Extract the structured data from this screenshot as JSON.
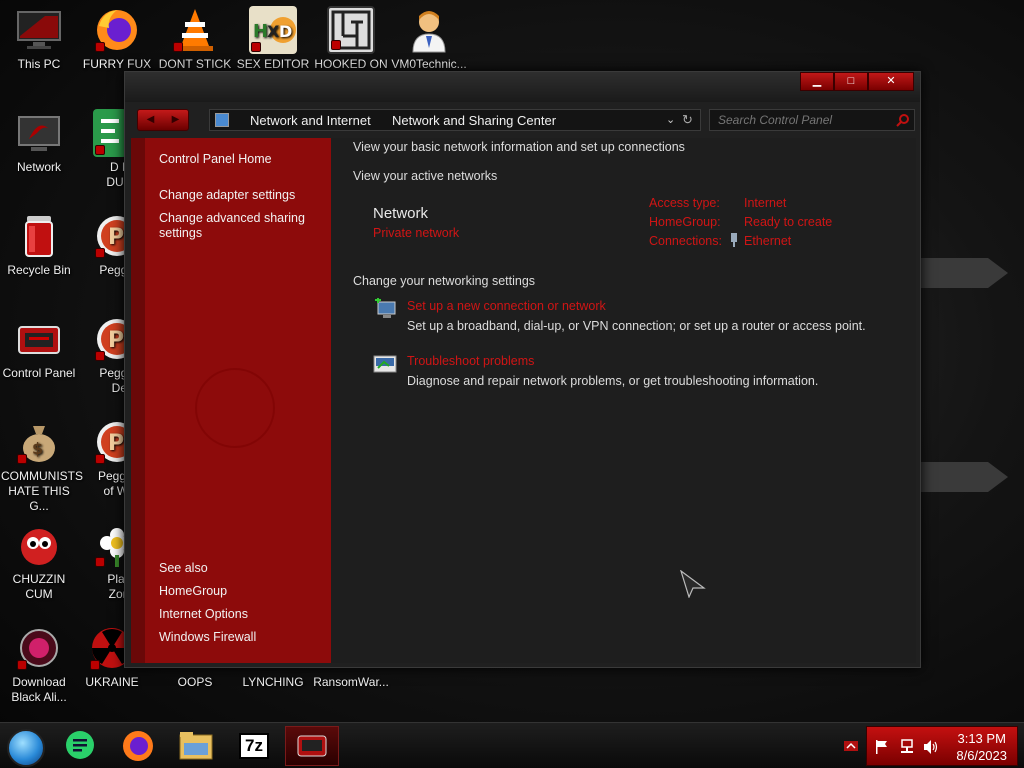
{
  "desktop": {
    "icons": [
      {
        "label": "This PC",
        "label2": ""
      },
      {
        "label": "FURRY FUX",
        "label2": ""
      },
      {
        "label": "DONT STICK",
        "label2": ""
      },
      {
        "label": "SEX EDITOR",
        "label2": ""
      },
      {
        "label": "HOOKED ON",
        "label2": ""
      },
      {
        "label": "VM0Technic...",
        "label2": ""
      },
      {
        "label": "Network",
        "label2": ""
      },
      {
        "label": "D FC",
        "label2": "DUMB"
      },
      {
        "label": "Recycle Bin",
        "label2": ""
      },
      {
        "label": "Peggle D",
        "label2": ""
      },
      {
        "label": "Control Panel",
        "label2": ""
      },
      {
        "label": "Peggle N",
        "label2": "Delu"
      },
      {
        "label": "COMMUNISTS",
        "label2": "HATE THIS G..."
      },
      {
        "label": "Peggle W",
        "label2": "of Warc"
      },
      {
        "label": "CHUZZIN",
        "label2": "CUM"
      },
      {
        "label": "Plants",
        "label2": "Zomb"
      },
      {
        "label": "Download",
        "label2": "Black Ali..."
      },
      {
        "label": "UKRAINE",
        "label2": ""
      },
      {
        "label": "OOPS",
        "label2": ""
      },
      {
        "label": "LYNCHING",
        "label2": ""
      },
      {
        "label": "RansomWar...",
        "label2": ""
      }
    ]
  },
  "window": {
    "buttons": {
      "minimize": "▁",
      "maximize": "□",
      "close": "✕"
    },
    "nav": {
      "back": "◀",
      "forward": "▶"
    },
    "address": {
      "crumb1": "Network and Internet",
      "crumb2": "Network and Sharing Center",
      "dropdown": "⌄",
      "refresh": "↻"
    },
    "search": {
      "placeholder": "Search Control Panel"
    },
    "left": {
      "home": "Control Panel Home",
      "adapter": "Change adapter settings",
      "sharing": "Change advanced sharing settings",
      "see_also": "See also",
      "homegroup": "HomeGroup",
      "internet_options": "Internet Options",
      "firewall": "Windows Firewall"
    },
    "main": {
      "heading": "View your basic network information and set up connections",
      "active_networks": "View your active networks",
      "network_name": "Network",
      "network_type": "Private network",
      "access_type_label": "Access type:",
      "access_type_value": "Internet",
      "homegroup_label": "HomeGroup:",
      "homegroup_value": "Ready to create",
      "connections_label": "Connections:",
      "connections_value": "Ethernet",
      "change_settings": "Change your networking settings",
      "setup_link": "Set up a new connection or network",
      "setup_desc": "Set up a broadband, dial-up, or VPN connection; or set up a router or access point.",
      "troubleshoot_link": "Troubleshoot problems",
      "troubleshoot_desc": "Diagnose and repair network problems, or get troubleshooting information."
    }
  },
  "taskbar": {
    "time": "3:13 PM",
    "date": "8/6/2023",
    "archive_label": "7z"
  },
  "colors": {
    "accent_red": "#d01515",
    "pane_red": "#8d0b0b",
    "window_bg": "#1e1e1e"
  }
}
